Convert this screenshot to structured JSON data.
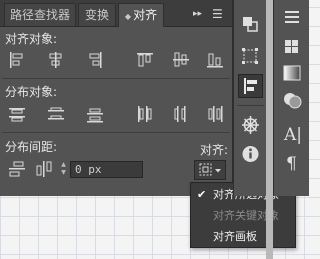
{
  "tabs": [
    {
      "label": "路径查找器"
    },
    {
      "label": "变换"
    },
    {
      "label": "对齐",
      "active": true
    }
  ],
  "tab_controls": {
    "expand_glyph": "▸▸",
    "menu_glyph": "☰"
  },
  "align_objects": {
    "label": "对齐对象:",
    "buttons": [
      {
        "name": "horizontal-align-left-icon"
      },
      {
        "name": "horizontal-align-center-icon"
      },
      {
        "name": "horizontal-align-right-icon"
      },
      {
        "name": "vertical-align-top-icon"
      },
      {
        "name": "vertical-align-center-icon"
      },
      {
        "name": "vertical-align-bottom-icon"
      }
    ]
  },
  "distribute_objects": {
    "label": "分布对象:",
    "buttons": [
      {
        "name": "vertical-distribute-top-icon"
      },
      {
        "name": "vertical-distribute-center-icon"
      },
      {
        "name": "vertical-distribute-bottom-icon"
      },
      {
        "name": "horizontal-distribute-left-icon"
      },
      {
        "name": "horizontal-distribute-center-icon"
      },
      {
        "name": "horizontal-distribute-right-icon"
      }
    ]
  },
  "distribute_spacing": {
    "label": "分布间距:",
    "value": "0 px",
    "buttons": [
      {
        "name": "vertical-distribute-space-icon"
      },
      {
        "name": "horizontal-distribute-space-icon"
      }
    ]
  },
  "align_to": {
    "label": "对齐:",
    "options": [
      {
        "label": "对齐所选对象",
        "checked": true,
        "disabled": false
      },
      {
        "label": "对齐关键对象",
        "checked": false,
        "disabled": true
      },
      {
        "label": "对齐画板",
        "checked": false,
        "disabled": false
      }
    ]
  },
  "tool_strip": {
    "items": [
      "pathfinder-icon",
      "transform-icon",
      "align-icon",
      "symbols-icon",
      "info-icon"
    ],
    "active": "align-icon"
  },
  "right_strip": {
    "items": [
      "menu-lines-icon",
      "swatches-icon",
      "gradient-icon",
      "transparency-icon",
      "character-icon",
      "paragraph-icon"
    ],
    "character_glyph": "A|",
    "paragraph_glyph": "¶"
  },
  "colors": {
    "panel": "#535353",
    "tabbar": "#3d3d3d",
    "dropdown": "#3c3c3c"
  }
}
